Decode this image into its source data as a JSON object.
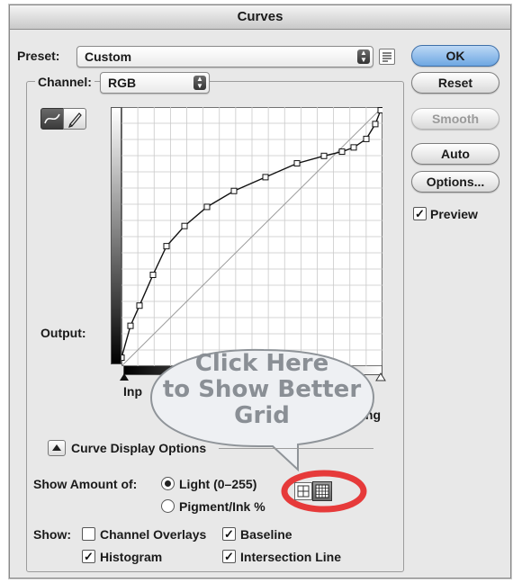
{
  "window": {
    "title": "Curves"
  },
  "preset": {
    "label": "Preset:",
    "value": "Custom"
  },
  "channel": {
    "label": "Channel:",
    "value": "RGB"
  },
  "buttons": {
    "ok": "OK",
    "reset": "Reset",
    "smooth": "Smooth",
    "auto": "Auto",
    "options": "Options..."
  },
  "preview": {
    "label": "Preview",
    "checked": true
  },
  "graph": {
    "output_label": "Output:",
    "input_label_partial": "Inp",
    "clipping_label_partial": "ing",
    "curve_points": [
      [
        0,
        8
      ],
      [
        10,
        38
      ],
      [
        20,
        57
      ],
      [
        35,
        86
      ],
      [
        50,
        113
      ],
      [
        70,
        132
      ],
      [
        95,
        150
      ],
      [
        125,
        165
      ],
      [
        160,
        178
      ],
      [
        195,
        191
      ],
      [
        225,
        198
      ],
      [
        245,
        202
      ],
      [
        258,
        206
      ],
      [
        272,
        214
      ],
      [
        282,
        228
      ],
      [
        288,
        241
      ]
    ],
    "diagonal": true
  },
  "callout": {
    "line1": "Click Here",
    "line2": "to Show Better",
    "line3": "Grid"
  },
  "curve_display_options": {
    "label": "Curve Display Options"
  },
  "show_amount": {
    "label": "Show Amount of:",
    "light": "Light  (0–255)",
    "pigment": "Pigment/Ink %",
    "selected": "light"
  },
  "show": {
    "label": "Show:",
    "channel_overlays": {
      "label": "Channel Overlays",
      "checked": false
    },
    "baseline": {
      "label": "Baseline",
      "checked": true
    },
    "histogram": {
      "label": "Histogram",
      "checked": true
    },
    "intersection_line": {
      "label": "Intersection Line",
      "checked": true
    }
  },
  "colors": {
    "highlight_ring": "#e63a3a",
    "ok_button": "#7fb2e6",
    "callout_fill": "#f0f2f4"
  }
}
